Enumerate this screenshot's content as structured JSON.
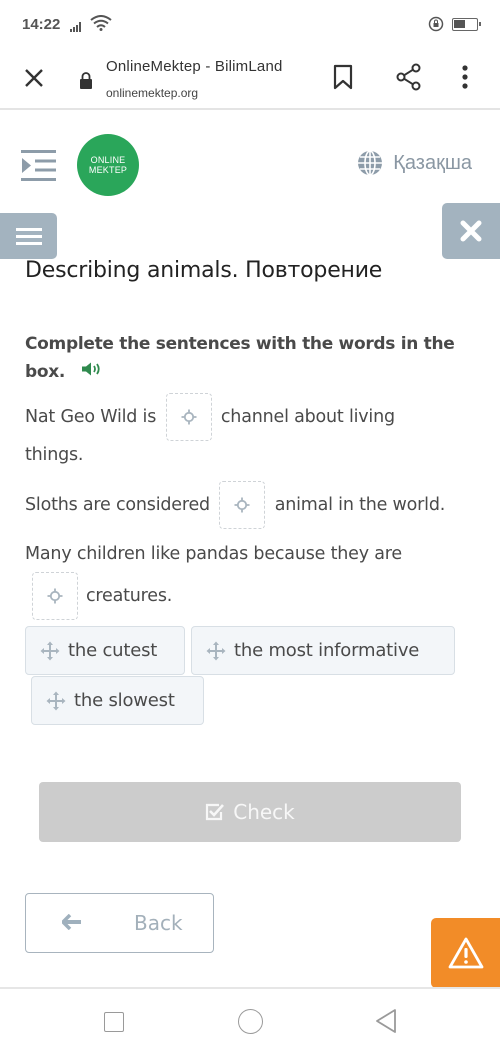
{
  "status_bar": {
    "time": "14:22"
  },
  "browser": {
    "title": "OnlineMektep - BilimLand",
    "url": "onlinemektep.org",
    "icons": [
      "close-icon",
      "lock-icon",
      "bookmark-icon",
      "share-icon",
      "more-vert-icon"
    ]
  },
  "header": {
    "logo_line1": "ONLINE",
    "logo_line2": "MEKTEP",
    "language": "Қазақша",
    "brand_color": "#2aa65a"
  },
  "lesson": {
    "title": "Describing animals. Повторение",
    "instruction": "Complete the sentences with the words in the box.",
    "sentences": [
      {
        "before": "Nat Geo Wild is",
        "after": "channel about living",
        "after2": "things."
      },
      {
        "before": "Sloths are considered",
        "after": "animal in the world."
      },
      {
        "before": "Many children like pandas because they are",
        "after": "creatures."
      }
    ],
    "word_options": [
      "the cutest",
      "the most informative",
      "the slowest"
    ]
  },
  "actions": {
    "check_label": "Check",
    "back_label": "Back",
    "report_color": "#f28c28"
  }
}
